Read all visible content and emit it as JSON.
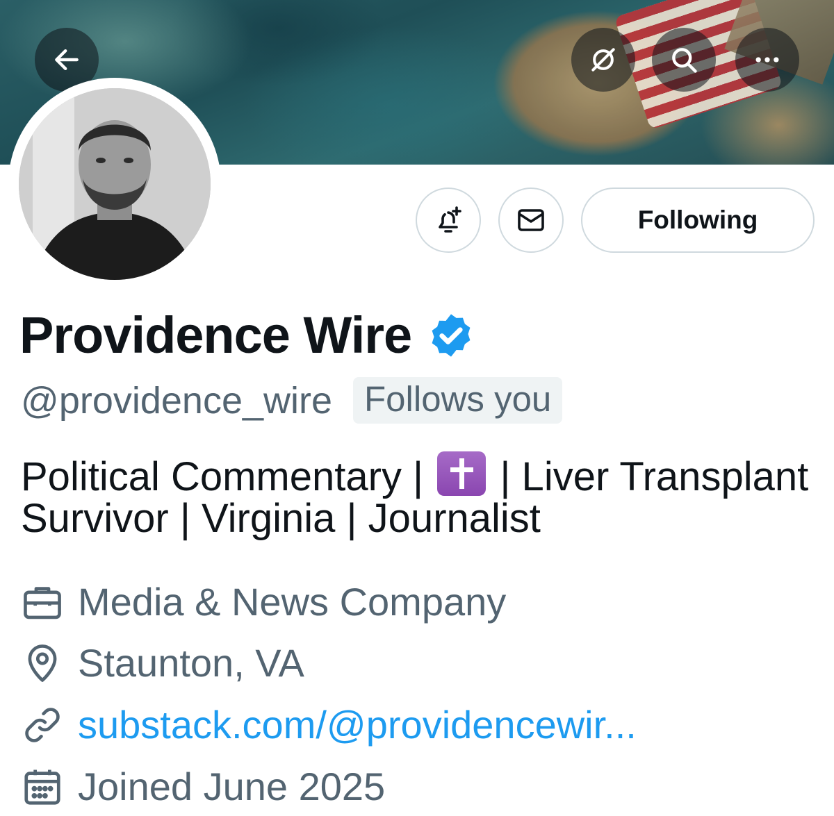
{
  "header": {
    "back_icon": "arrow-left-icon",
    "grok_icon": "grok-icon",
    "search_icon": "search-icon",
    "more_icon": "more-icon"
  },
  "actions": {
    "notify_icon": "bell-plus-icon",
    "message_icon": "envelope-icon",
    "following_label": "Following"
  },
  "profile": {
    "name": "Providence Wire",
    "verified_icon": "verified-badge-icon",
    "handle": "@providence_wire",
    "follows_you": "Follows you",
    "bio_part1": "Political Commentary |",
    "bio_emoji": "latin-cross-emoji",
    "bio_part2": "| Liver Transplant Survivor | Virginia | Journalist",
    "category": "Media & News Company",
    "location": "Staunton, VA",
    "website": "substack.com/@providencewir...",
    "joined": "Joined June 2025"
  },
  "colors": {
    "accent": "#1d9bf0",
    "secondary_text": "#536471",
    "border": "#cfd9de"
  }
}
